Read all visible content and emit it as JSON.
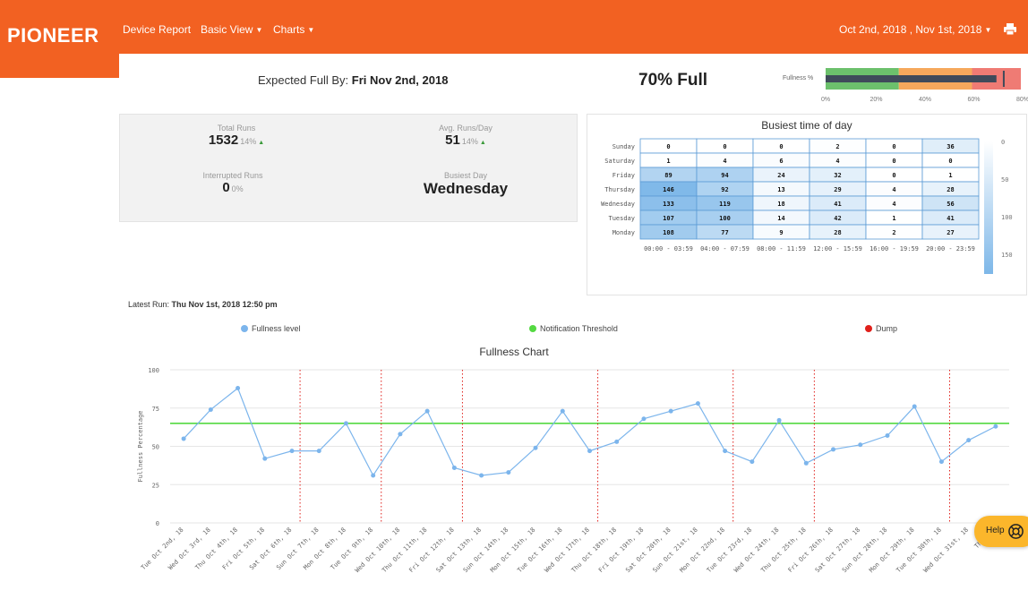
{
  "brand": {
    "logo": "PIONEER",
    "accent": "#f26122"
  },
  "nav": {
    "device_report": "Device Report",
    "basic_view": "Basic View",
    "charts": "Charts",
    "date_range": "Oct 2nd, 2018 , Nov 1st, 2018",
    "print_icon": "print-icon"
  },
  "summary": {
    "expected_label": "Expected Full By:",
    "expected_date": "Fri Nov 2nd, 2018",
    "full_text": "70% Full",
    "fullness_label": "Fullness %",
    "gauge": {
      "value": 70,
      "target": 73,
      "bands": [
        {
          "from": 0,
          "to": 30,
          "color": "#6cc06c"
        },
        {
          "from": 30,
          "to": 60,
          "color": "#f6a85c"
        },
        {
          "from": 60,
          "to": 80,
          "color": "#ef7b74"
        }
      ],
      "ticks": [
        "0%",
        "20%",
        "40%",
        "60%",
        "80%"
      ]
    }
  },
  "stats": {
    "total_runs_label": "Total Runs",
    "total_runs_value": "1532",
    "total_runs_change": "14%",
    "avg_runs_label": "Avg. Runs/Day",
    "avg_runs_value": "51",
    "avg_runs_change": "14%",
    "interrupted_label": "Interrupted Runs",
    "interrupted_value": "0",
    "interrupted_change": "0%",
    "busiest_day_label": "Busiest Day",
    "busiest_day_value": "Wednesday"
  },
  "heatmap": {
    "title": "Busiest time of day",
    "days": [
      "Sunday",
      "Saturday",
      "Friday",
      "Thursday",
      "Wednesday",
      "Tuesday",
      "Monday"
    ],
    "slots": [
      "00:00 - 03:59",
      "04:00 - 07:59",
      "08:00 - 11:59",
      "12:00 - 15:59",
      "16:00 - 19:59",
      "20:00 - 23:59"
    ],
    "values": [
      [
        0,
        0,
        0,
        2,
        0,
        36
      ],
      [
        1,
        4,
        6,
        4,
        0,
        0
      ],
      [
        89,
        94,
        24,
        32,
        0,
        1
      ],
      [
        146,
        92,
        13,
        29,
        4,
        28
      ],
      [
        133,
        119,
        18,
        41,
        4,
        56
      ],
      [
        107,
        100,
        14,
        42,
        1,
        41
      ],
      [
        108,
        77,
        9,
        28,
        2,
        27
      ]
    ],
    "scale_labels": [
      "0",
      "50",
      "100",
      "150"
    ],
    "min_color": "#ffffff",
    "max_color": "#7db7e8"
  },
  "latest": {
    "label": "Latest Run:",
    "value": "Thu Nov 1st, 2018 12:50 pm"
  },
  "legend": [
    {
      "label": "Fullness level",
      "color": "#7cb5ec"
    },
    {
      "label": "Notification Threshold",
      "color": "#54d942"
    },
    {
      "label": "Dump",
      "color": "#e0201b"
    }
  ],
  "chart_data": {
    "type": "line",
    "title": "Fullness Chart",
    "ylabel": "Fullness Percentage",
    "ylim": [
      0,
      100
    ],
    "yticks": [
      0,
      25,
      50,
      75,
      100
    ],
    "categories": [
      "Tue Oct 2nd, 18",
      "Wed Oct 3rd, 18",
      "Thu Oct 4th, 18",
      "Fri Oct 5th, 18",
      "Sat Oct 6th, 18",
      "Sun Oct 7th, 18",
      "Mon Oct 8th, 18",
      "Tue Oct 9th, 18",
      "Wed Oct 10th, 18",
      "Thu Oct 11th, 18",
      "Fri Oct 12th, 18",
      "Sat Oct 13th, 18",
      "Sun Oct 14th, 18",
      "Mon Oct 15th, 18",
      "Tue Oct 16th, 18",
      "Wed Oct 17th, 18",
      "Thu Oct 18th, 18",
      "Fri Oct 19th, 18",
      "Sat Oct 20th, 18",
      "Sun Oct 21st, 18",
      "Mon Oct 22nd, 18",
      "Tue Oct 23rd, 18",
      "Wed Oct 24th, 18",
      "Thu Oct 25th, 18",
      "Fri Oct 26th, 18",
      "Sat Oct 27th, 18",
      "Sun Oct 28th, 18",
      "Mon Oct 29th, 18",
      "Tue Oct 30th, 18",
      "Wed Oct 31st, 18",
      "Thu Nov"
    ],
    "series": [
      {
        "name": "Fullness level",
        "color": "#7cb5ec",
        "points": [
          [
            0,
            55
          ],
          [
            1,
            74
          ],
          [
            2,
            88
          ],
          [
            3,
            42
          ],
          [
            4,
            47
          ],
          [
            5,
            47
          ],
          [
            6,
            65
          ],
          [
            7,
            31
          ],
          [
            8,
            58
          ],
          [
            9,
            73
          ],
          [
            10,
            36
          ],
          [
            11,
            31
          ],
          [
            12,
            33
          ],
          [
            13,
            49
          ],
          [
            14,
            73
          ],
          [
            15,
            47
          ],
          [
            16,
            53
          ],
          [
            17,
            68
          ],
          [
            18,
            73
          ],
          [
            19,
            78
          ],
          [
            20,
            47
          ],
          [
            21,
            40
          ],
          [
            22,
            67
          ],
          [
            23,
            39
          ],
          [
            24,
            48
          ],
          [
            25,
            51
          ],
          [
            26,
            57
          ],
          [
            27,
            76
          ],
          [
            28,
            40
          ],
          [
            29,
            54
          ],
          [
            30,
            63
          ]
        ]
      }
    ],
    "threshold": {
      "name": "Notification Threshold",
      "value": 65,
      "color": "#54d942"
    },
    "dumps": {
      "name": "Dump",
      "color": "#e0201b",
      "x": [
        4.3,
        7.3,
        10.3,
        15.3,
        20.3,
        23.3,
        28.3
      ]
    },
    "grid": true
  },
  "help": {
    "label": "Help",
    "icon": "lifebuoy-icon"
  }
}
